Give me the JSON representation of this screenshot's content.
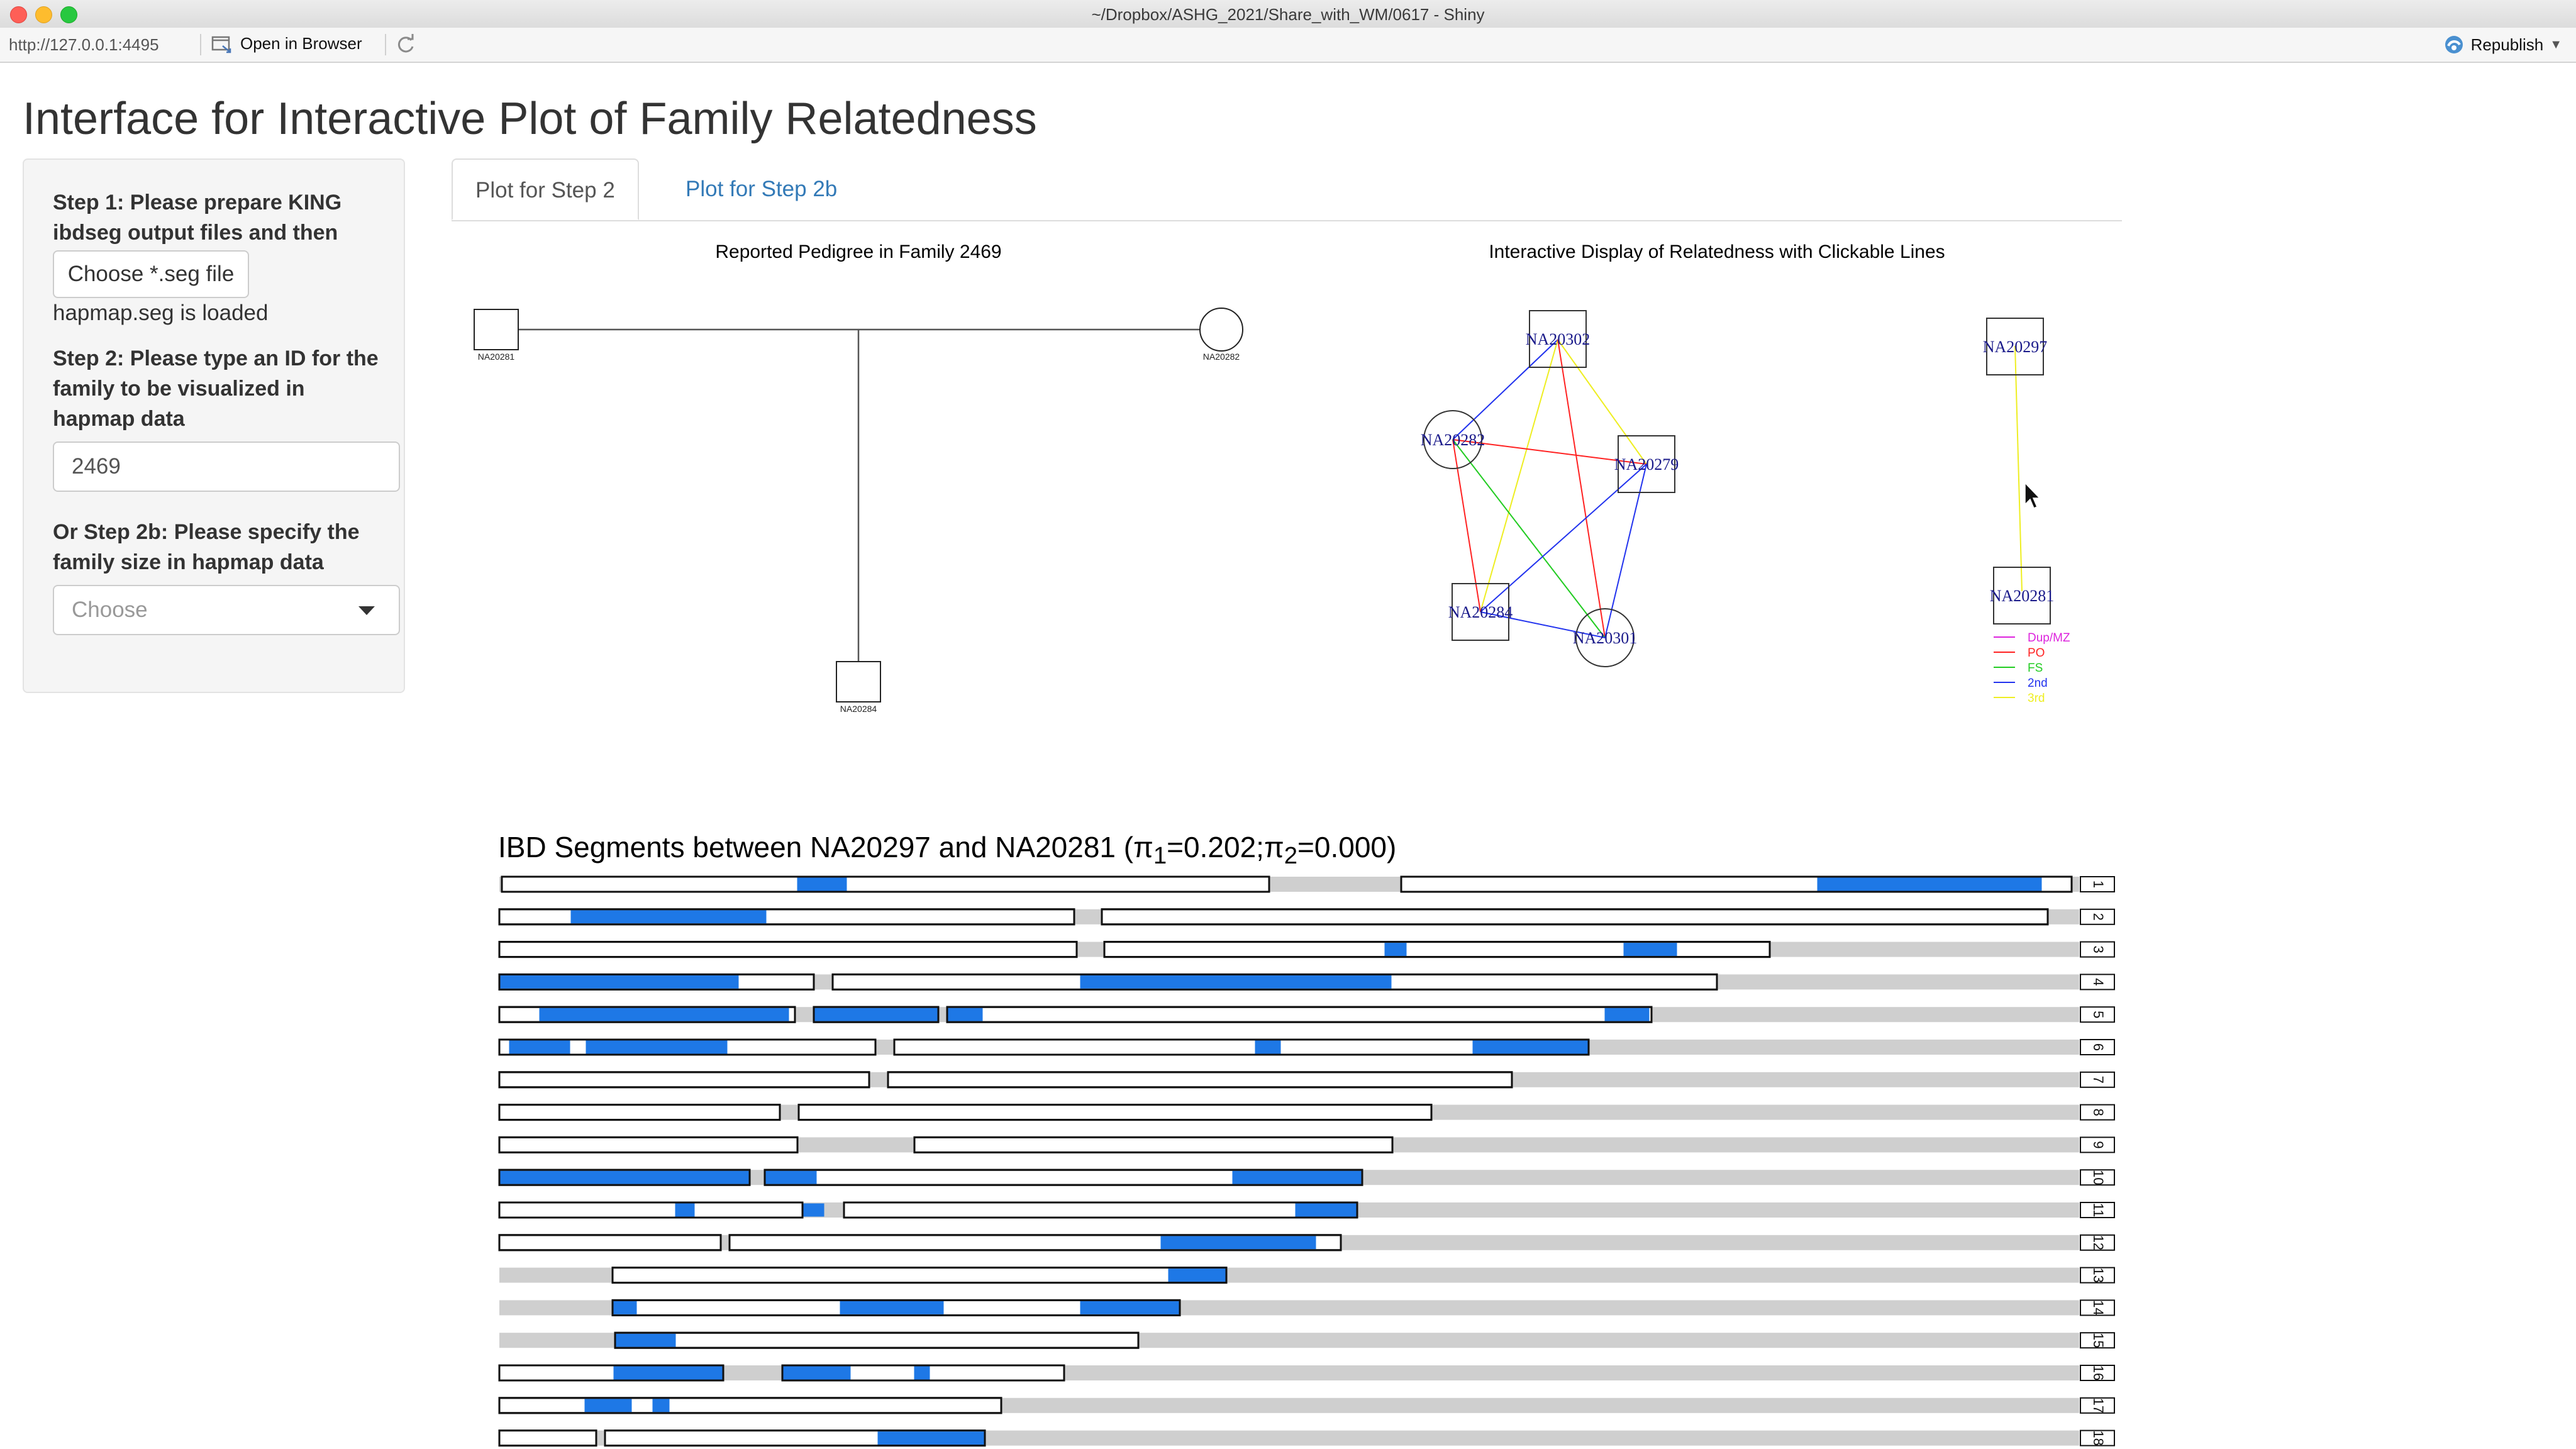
{
  "window": {
    "title": "~/Dropbox/ASHG_2021/Share_with_WM/0617 - Shiny"
  },
  "toolbar": {
    "url": "http://127.0.0.1:4495",
    "open_browser": "Open in Browser",
    "republish": "Republish"
  },
  "page": {
    "title": "Interface for Interactive Plot of Family Relatedness"
  },
  "sidebar": {
    "step1_label": "Step 1: Please prepare KING ibdseg output files and then",
    "file_button": "Choose *.seg file",
    "loaded_note": "hapmap.seg is loaded",
    "step2_label": "Step 2: Please type an ID for the family to be visualized in hapmap data",
    "family_id_value": "2469",
    "step2b_label": "Or Step 2b: Please specify the family size in hapmap data",
    "family_size_placeholder": "Choose"
  },
  "tabs": [
    {
      "label": "Plot for Step 2",
      "active": true
    },
    {
      "label": "Plot for Step 2b",
      "active": false
    }
  ],
  "pedigree": {
    "title": "Reported Pedigree in Family 2469",
    "father": "NA20281",
    "mother": "NA20282",
    "child": "NA20284"
  },
  "network": {
    "title": "Interactive Display of Relatedness with Clickable Lines",
    "nodes": {
      "n302": "NA20302",
      "n282": "NA20282",
      "n279": "NA20279",
      "n284": "NA20284",
      "n301": "NA20301",
      "n297": "NA20297",
      "n281": "NA20281"
    },
    "legend": [
      {
        "label": "Dup/MZ",
        "color": "#dd22dd"
      },
      {
        "label": "PO",
        "color": "#ff2222"
      },
      {
        "label": "FS",
        "color": "#22cc22"
      },
      {
        "label": "2nd",
        "color": "#2233ee"
      },
      {
        "label": "3rd",
        "color": "#eeee22"
      }
    ]
  },
  "ibd": {
    "title_prefix": "IBD Segments between NA20297 and NA20281 (",
    "pi": "π",
    "sub1": "1",
    "val1": "=0.202;",
    "sub2": "2",
    "val2": "=0.000)",
    "segment_color": "#1e78e6",
    "chromosomes": [
      "1",
      "2",
      "3",
      "4",
      "5",
      "6",
      "7",
      "8",
      "9",
      "10",
      "11",
      "12",
      "13",
      "14",
      "15",
      "16",
      "17",
      "18"
    ]
  }
}
